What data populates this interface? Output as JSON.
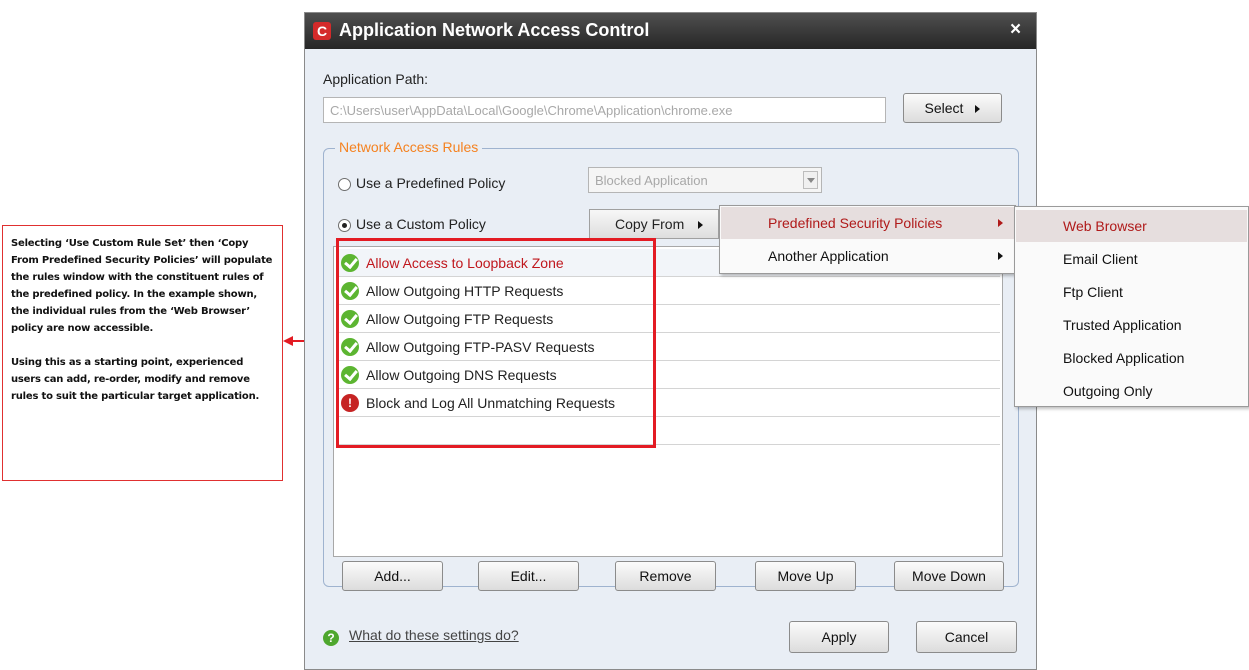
{
  "annotation": {
    "paragraphs": [
      "Selecting ‘Use Custom Rule Set’ then ‘Copy From Predefined Security Policies’ will populate the rules window with the constituent rules of the predefined policy. In the example shown, the individual rules from the ‘Web Browser’ policy are now accessible.",
      "Using this as a starting point, experienced users can add, re-order, modify and remove rules to suit the particular target application."
    ]
  },
  "dialog": {
    "title": "Application Network Access Control",
    "app_icon_letter": "C",
    "close_glyph": "×",
    "path_label": "Application Path:",
    "path_value": "C:\\Users\\user\\AppData\\Local\\Google\\Chrome\\Application\\chrome.exe",
    "select_label": "Select",
    "group_title": "Network Access Rules",
    "predefined_label": "Use a Predefined Policy",
    "predefined_value": "Blocked Application",
    "custom_label": "Use a Custom Policy",
    "selected_policy_mode": "custom",
    "copy_from_label": "Copy From",
    "rules": [
      {
        "label": "Allow Access to Loopback Zone",
        "status": "allow",
        "selected": true
      },
      {
        "label": "Allow Outgoing HTTP Requests",
        "status": "allow"
      },
      {
        "label": "Allow Outgoing FTP Requests",
        "status": "allow"
      },
      {
        "label": "Allow Outgoing FTP-PASV Requests",
        "status": "allow"
      },
      {
        "label": "Allow Outgoing DNS Requests",
        "status": "allow"
      },
      {
        "label": "Block and Log All Unmatching Requests",
        "status": "block"
      }
    ],
    "buttons": {
      "add": "Add...",
      "edit": "Edit...",
      "remove": "Remove",
      "move_up": "Move Up",
      "move_down": "Move Down",
      "apply": "Apply",
      "cancel": "Cancel"
    },
    "help_link": "What do these settings do?"
  },
  "copy_from_menu": {
    "items": [
      {
        "label": "Predefined Security Policies",
        "highlighted": true
      },
      {
        "label": "Another Application",
        "highlighted": false
      }
    ]
  },
  "policies_menu": {
    "items": [
      {
        "label": "Web Browser",
        "highlighted": true
      },
      {
        "label": "Email Client"
      },
      {
        "label": "Ftp Client"
      },
      {
        "label": "Trusted Application"
      },
      {
        "label": "Blocked Application"
      },
      {
        "label": "Outgoing Only"
      }
    ]
  },
  "colors": {
    "group_title": "#f58220",
    "highlight_border": "#e31b23",
    "menu_highlight_text": "#b01a1a",
    "allow_icon": "#5cb531",
    "block_icon": "#c62424"
  }
}
